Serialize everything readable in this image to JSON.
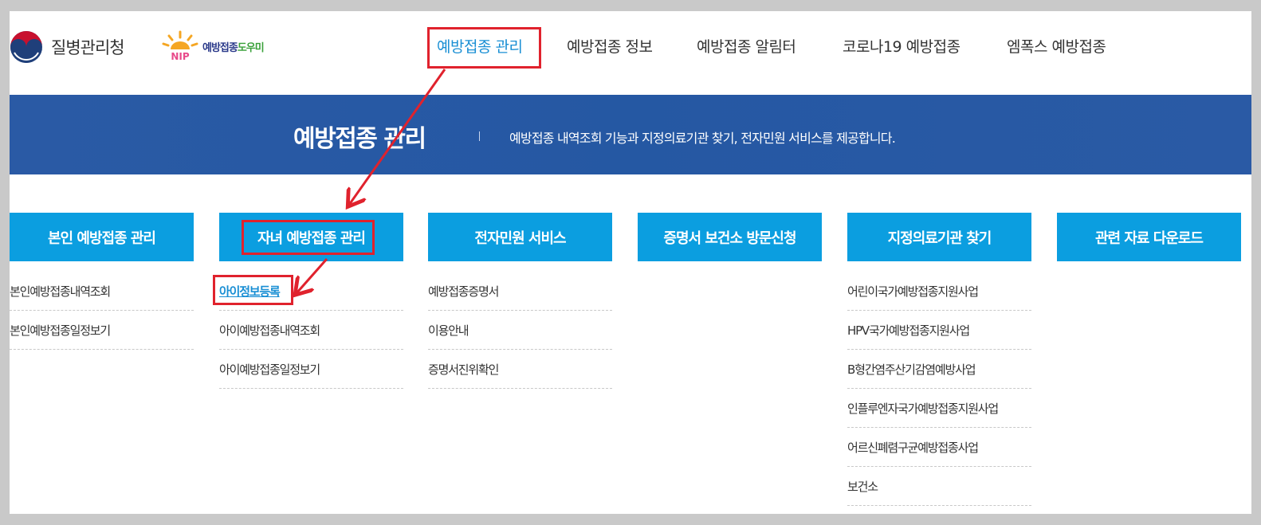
{
  "header": {
    "agency_logo": {
      "text": "질병관리청",
      "icon": "kdca-taegeuk-emblem"
    },
    "service_logo": {
      "text_main": "예방접종",
      "text_accent": "도우미",
      "icon": "ntip-sun-logo",
      "emblem_letters": "NIP"
    },
    "nav": [
      {
        "label": "예방접종 관리",
        "active": true
      },
      {
        "label": "예방접종 정보",
        "active": false
      },
      {
        "label": "예방접종 알림터",
        "active": false
      },
      {
        "label": "코로나19 예방접종",
        "active": false
      },
      {
        "label": "엠폭스 예방접종",
        "active": false
      }
    ]
  },
  "banner": {
    "title": "예방접종 관리",
    "description": "예방접종 내역조회 기능과 지정의료기관 찾기, 전자민원 서비스를 제공합니다."
  },
  "menu": [
    {
      "title": "본인 예방접종 관리",
      "items": [
        "본인예방접종내역조회",
        "본인예방접종일정보기"
      ]
    },
    {
      "title": "자녀 예방접종 관리",
      "items": [
        "아이정보등록",
        "아이예방접종내역조회",
        "아이예방접종일정보기"
      ]
    },
    {
      "title": "전자민원 서비스",
      "items": [
        "예방접종증명서",
        "이용안내",
        "증명서진위확인"
      ]
    },
    {
      "title": "증명서 보건소 방문신청",
      "items": []
    },
    {
      "title": "지정의료기관 찾기",
      "items": [
        "어린이국가예방접종지원사업",
        "HPV국가예방접종지원사업",
        "B형간염주산기감염예방사업",
        "인플루엔자국가예방접종지원사업",
        "어르신폐렴구균예방접종사업",
        "보건소"
      ]
    },
    {
      "title": "관련 자료 다운로드",
      "items": []
    }
  ],
  "annotation_color": "#e0222d",
  "colors": {
    "banner": "#2a5aa5",
    "menu_head": "#0b9ee0",
    "active_link": "#1a8fd4"
  }
}
